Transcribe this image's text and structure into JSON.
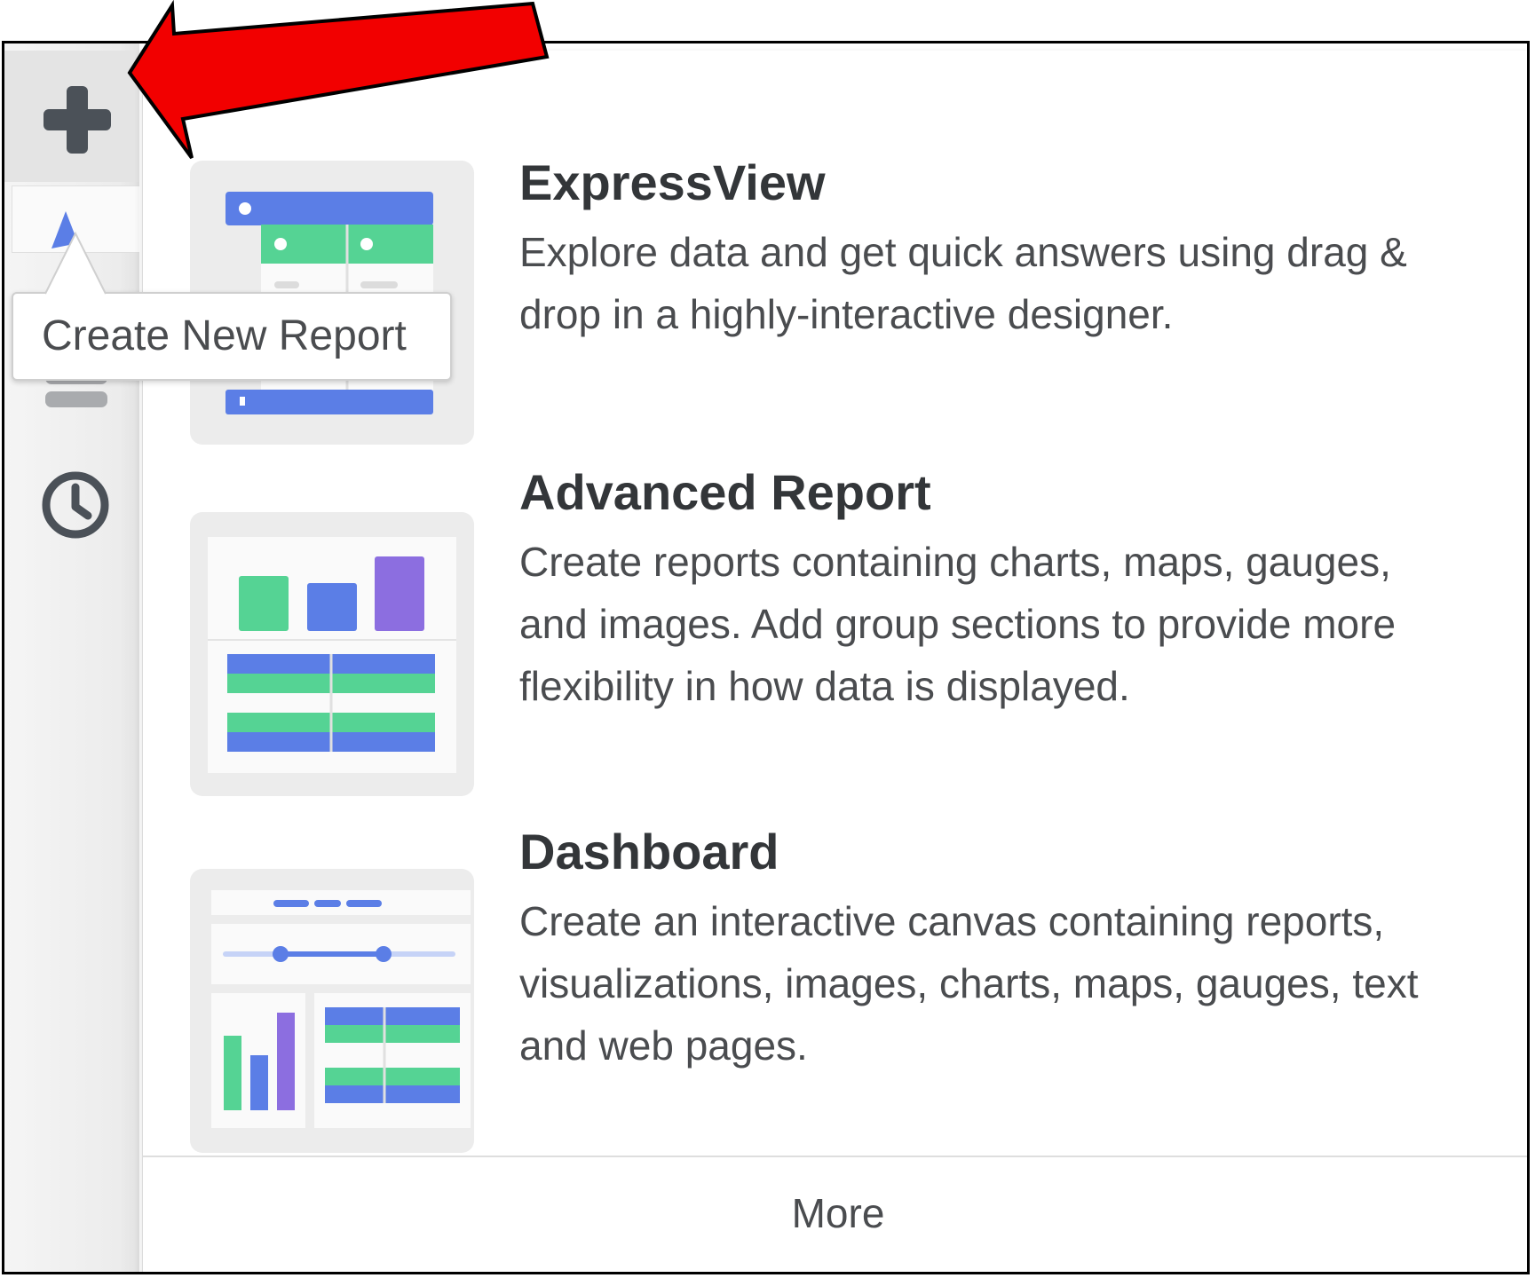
{
  "sidebar": {
    "items": [
      {
        "icon": "plus-icon",
        "active": true
      },
      {
        "icon": "report-icon"
      },
      {
        "icon": "database-icon"
      },
      {
        "icon": "clock-icon"
      }
    ]
  },
  "tooltip": {
    "text": "Create New Report"
  },
  "options": [
    {
      "title": "ExpressView",
      "description": "Explore data and get quick answers using drag & drop in a highly-interactive designer.",
      "icon": "expressview-thumbnail-icon"
    },
    {
      "title": "Advanced Report",
      "description": "Create reports containing charts, maps, gauges, and images. Add group sections to provide more flexibility in how data is displayed.",
      "icon": "advanced-report-thumbnail-icon"
    },
    {
      "title": "Dashboard",
      "description": "Create an interactive canvas containing reports, visualizations, images, charts, maps, gauges, text and web pages.",
      "icon": "dashboard-thumbnail-icon"
    }
  ],
  "more": {
    "label": "More"
  },
  "colors": {
    "blue": "#5b7ee6",
    "green": "#55d394",
    "purple": "#8c6ee0",
    "icon_dark": "#4b5158",
    "icon_light": "#a9abae",
    "annotation_red": "#f20000"
  }
}
